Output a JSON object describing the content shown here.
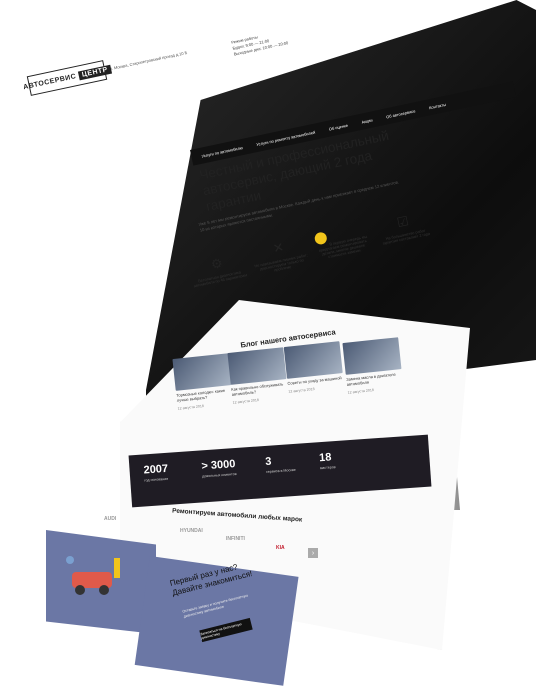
{
  "header": {
    "logo": "АВТОСЕРВИС",
    "logo_tag": "ЦЕНТР",
    "address": "г. Москва, Старопетровский проезд д.10 Б",
    "hours_title": "Режим работы",
    "hours_weekdays": "Будни: 9:00 — 21:00",
    "hours_weekend": "Выходные дни: 10:00 — 20:00"
  },
  "nav": {
    "items": [
      "Услуги по автомобилю",
      "Услуги по ремонту автомобилей",
      "Об оценке",
      "Акции",
      "Об автосервисе",
      "Контакты"
    ]
  },
  "hero": {
    "title": "Честный и профессиональный автосервис, дающий 2 года гарантии",
    "subtitle": "Уже 5 лет мы ремонтируем автомобили в Москве. Каждый день к нам приезжает в среднем 12 клиентов. 10 из которых являются постоянными."
  },
  "features": [
    {
      "text": "Бесплатная диагностика автомобиля по 46 параметрам",
      "icon": "car-lift-icon"
    },
    {
      "text": "Не навязываем лишних работ: диагностируем только по проблеме",
      "icon": "wrench-cross-icon"
    },
    {
      "text": "В первую очередь мы предлагаем ремонтировать детали, многие дешевле стоимости замены",
      "icon": "gear-icon"
    },
    {
      "text": "На большинство работ гарантия составляет 2 года",
      "icon": "checklist-icon"
    }
  ],
  "blog": {
    "title": "Блог нашего автосервиса",
    "cards": [
      {
        "title": "Тормозные колодки: какие лучше выбрать?",
        "date": "12 августа 2018"
      },
      {
        "title": "Как правильно обслуживать автомобиль?",
        "date": "12 августа 2018"
      },
      {
        "title": "Советы по уходу за машиной",
        "date": "12 августа 2018"
      },
      {
        "title": "Замена масла в двигателе автомобиля",
        "date": "12 августа 2018"
      }
    ]
  },
  "stats": [
    {
      "value": "2007",
      "label": "год основания"
    },
    {
      "value": "> 3000",
      "label": "довольных клиентов"
    },
    {
      "value": "3",
      "label": "сервиса в Москве"
    },
    {
      "value": "18",
      "label": "мастеров"
    }
  ],
  "brands": {
    "title": "Ремонтируем автомобили любых марок",
    "items": [
      "AUDI",
      "HYUNDAI",
      "INFINITI",
      "KIA"
    ],
    "next": "›"
  },
  "promo": {
    "title": "Первый раз у нас? Давайте знакомиться!",
    "text": "Оставьте заявку и получите бесплатную диагностику автомобиля",
    "button": "Записаться на бесплатную диагностику"
  }
}
